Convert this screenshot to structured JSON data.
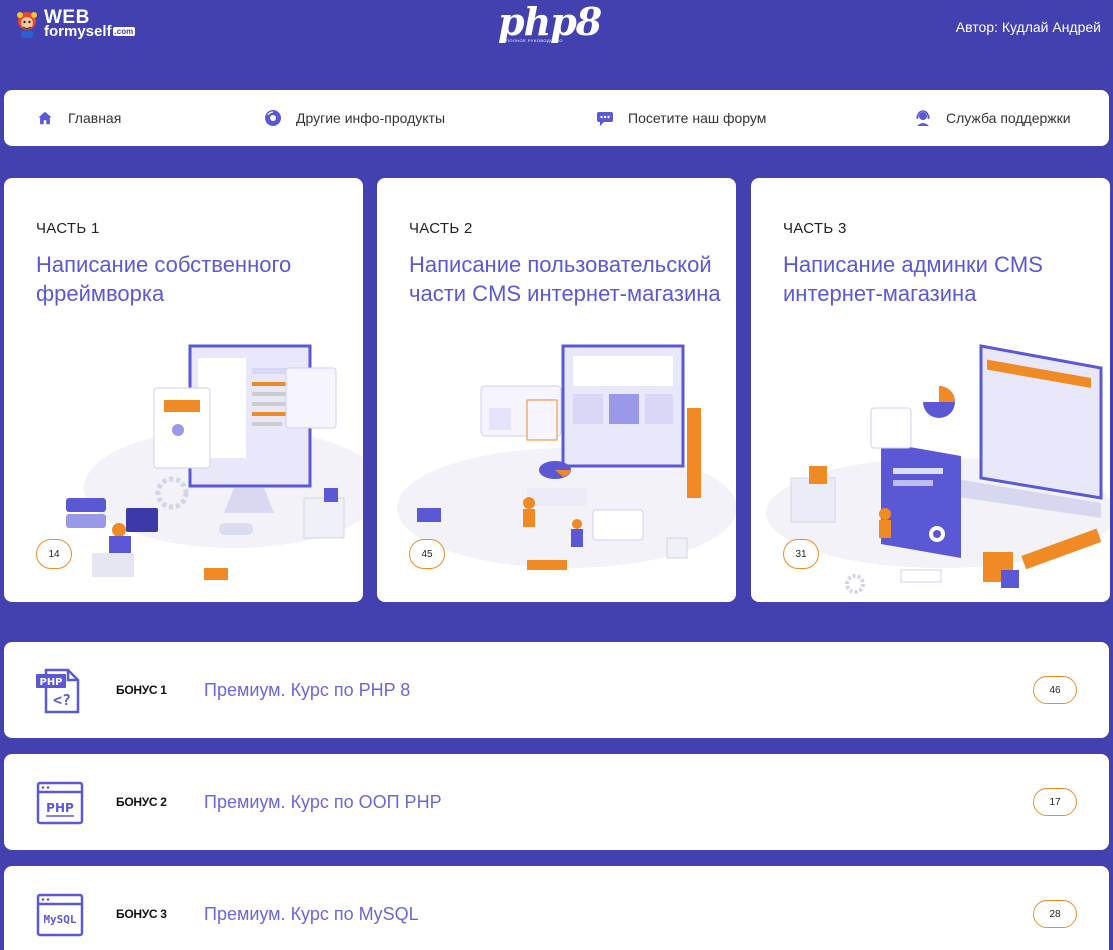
{
  "header": {
    "logo_web": "WEB",
    "logo_fms": "formyself",
    "logo_com": ".com",
    "logo_php": "php8",
    "logo_php_sub": "ПОЛНОЕ РУКОВОДСТВО",
    "author": "Автор: Кудлай Андрей"
  },
  "nav": [
    {
      "label": "Главная",
      "icon": "home-icon"
    },
    {
      "label": "Другие инфо-продукты",
      "icon": "disc-icon"
    },
    {
      "label": "Посетите наш форум",
      "icon": "chat-icon"
    },
    {
      "label": "Служба поддержки",
      "icon": "support-icon"
    }
  ],
  "parts": [
    {
      "kicker": "ЧАСТЬ 1",
      "title": "Написание собственного фреймворка",
      "count": "14"
    },
    {
      "kicker": "ЧАСТЬ 2",
      "title": "Написание пользовательской части CMS интернет-магазина",
      "count": "45"
    },
    {
      "kicker": "ЧАСТЬ 3",
      "title": "Написание админки CMS интернет-магазина",
      "count": "31"
    }
  ],
  "bonuses": [
    {
      "label": "БОНУС 1",
      "title": "Премиум. Курс по PHP 8",
      "count": "46",
      "icon": "php-file-icon"
    },
    {
      "label": "БОНУС 2",
      "title": "Премиум. Курс по ООП PHP",
      "count": "17",
      "icon": "php-window-icon"
    },
    {
      "label": "БОНУС 3",
      "title": "Премиум. Курс по MySQL",
      "count": "28",
      "icon": "mysql-window-icon"
    }
  ],
  "colors": {
    "background": "#4340b0",
    "accent": "#5b58d6",
    "badge_border": "#f08a24"
  }
}
